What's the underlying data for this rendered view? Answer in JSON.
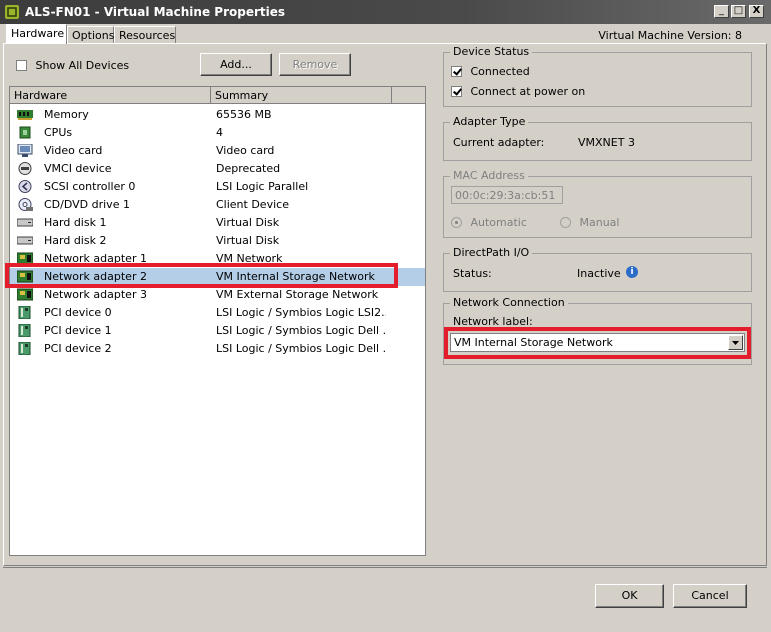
{
  "window": {
    "title": "ALS-FN01 - Virtual Machine Properties",
    "vm_version": "Virtual Machine Version: 8",
    "minimize": "_",
    "maximize": "□",
    "close": "X"
  },
  "tabs": [
    {
      "label": "Hardware",
      "active": true
    },
    {
      "label": "Options",
      "active": false
    },
    {
      "label": "Resources",
      "active": false
    }
  ],
  "toolbar": {
    "show_all_devices": "Show All Devices",
    "add": "Add...",
    "remove": "Remove"
  },
  "hardware_table": {
    "columns": [
      "Hardware",
      "Summary"
    ],
    "rows": [
      {
        "name": "Memory",
        "summary": "65536 MB",
        "icon": "memory-icon"
      },
      {
        "name": "CPUs",
        "summary": "4",
        "icon": "cpu-icon"
      },
      {
        "name": "Video card",
        "summary": "Video card",
        "icon": "monitor-icon"
      },
      {
        "name": "VMCI device",
        "summary": "Deprecated",
        "icon": "vmci-icon"
      },
      {
        "name": "SCSI controller 0",
        "summary": "LSI Logic Parallel",
        "icon": "scsi-icon"
      },
      {
        "name": "CD/DVD drive 1",
        "summary": "Client Device",
        "icon": "cd-icon"
      },
      {
        "name": "Hard disk 1",
        "summary": "Virtual Disk",
        "icon": "disk-icon"
      },
      {
        "name": "Hard disk 2",
        "summary": "Virtual Disk",
        "icon": "disk-icon"
      },
      {
        "name": "Network adapter 1",
        "summary": "VM Network",
        "icon": "nic-icon"
      },
      {
        "name": "Network adapter 2",
        "summary": "VM Internal Storage Network",
        "icon": "nic-icon",
        "selected": true
      },
      {
        "name": "Network adapter 3",
        "summary": "VM External Storage Network",
        "icon": "nic-icon"
      },
      {
        "name": "PCI device 0",
        "summary": "LSI Logic / Symbios Logic LSI2...",
        "icon": "pci-icon"
      },
      {
        "name": "PCI device 1",
        "summary": "LSI Logic / Symbios Logic Dell ...",
        "icon": "pci-icon"
      },
      {
        "name": "PCI device 2",
        "summary": "LSI Logic / Symbios Logic Dell ...",
        "icon": "pci-icon"
      }
    ]
  },
  "device_status": {
    "legend": "Device Status",
    "connected": "Connected",
    "connect_at_power_on": "Connect at power on"
  },
  "adapter_type": {
    "legend": "Adapter Type",
    "current_label": "Current adapter:",
    "current_value": "VMXNET 3"
  },
  "mac_address": {
    "legend": "MAC Address",
    "value": "00:0c:29:3a:cb:51",
    "automatic": "Automatic",
    "manual": "Manual"
  },
  "directpath": {
    "legend": "DirectPath I/O",
    "status_label": "Status:",
    "status_value": "Inactive"
  },
  "network_connection": {
    "legend": "Network Connection",
    "label": "Network label:",
    "selected": "VM Internal Storage Network"
  },
  "footer": {
    "ok": "OK",
    "cancel": "Cancel"
  },
  "colors": {
    "highlight": "#e31d2c",
    "selection": "#b5cee8",
    "dialog": "#d4d0c8"
  }
}
